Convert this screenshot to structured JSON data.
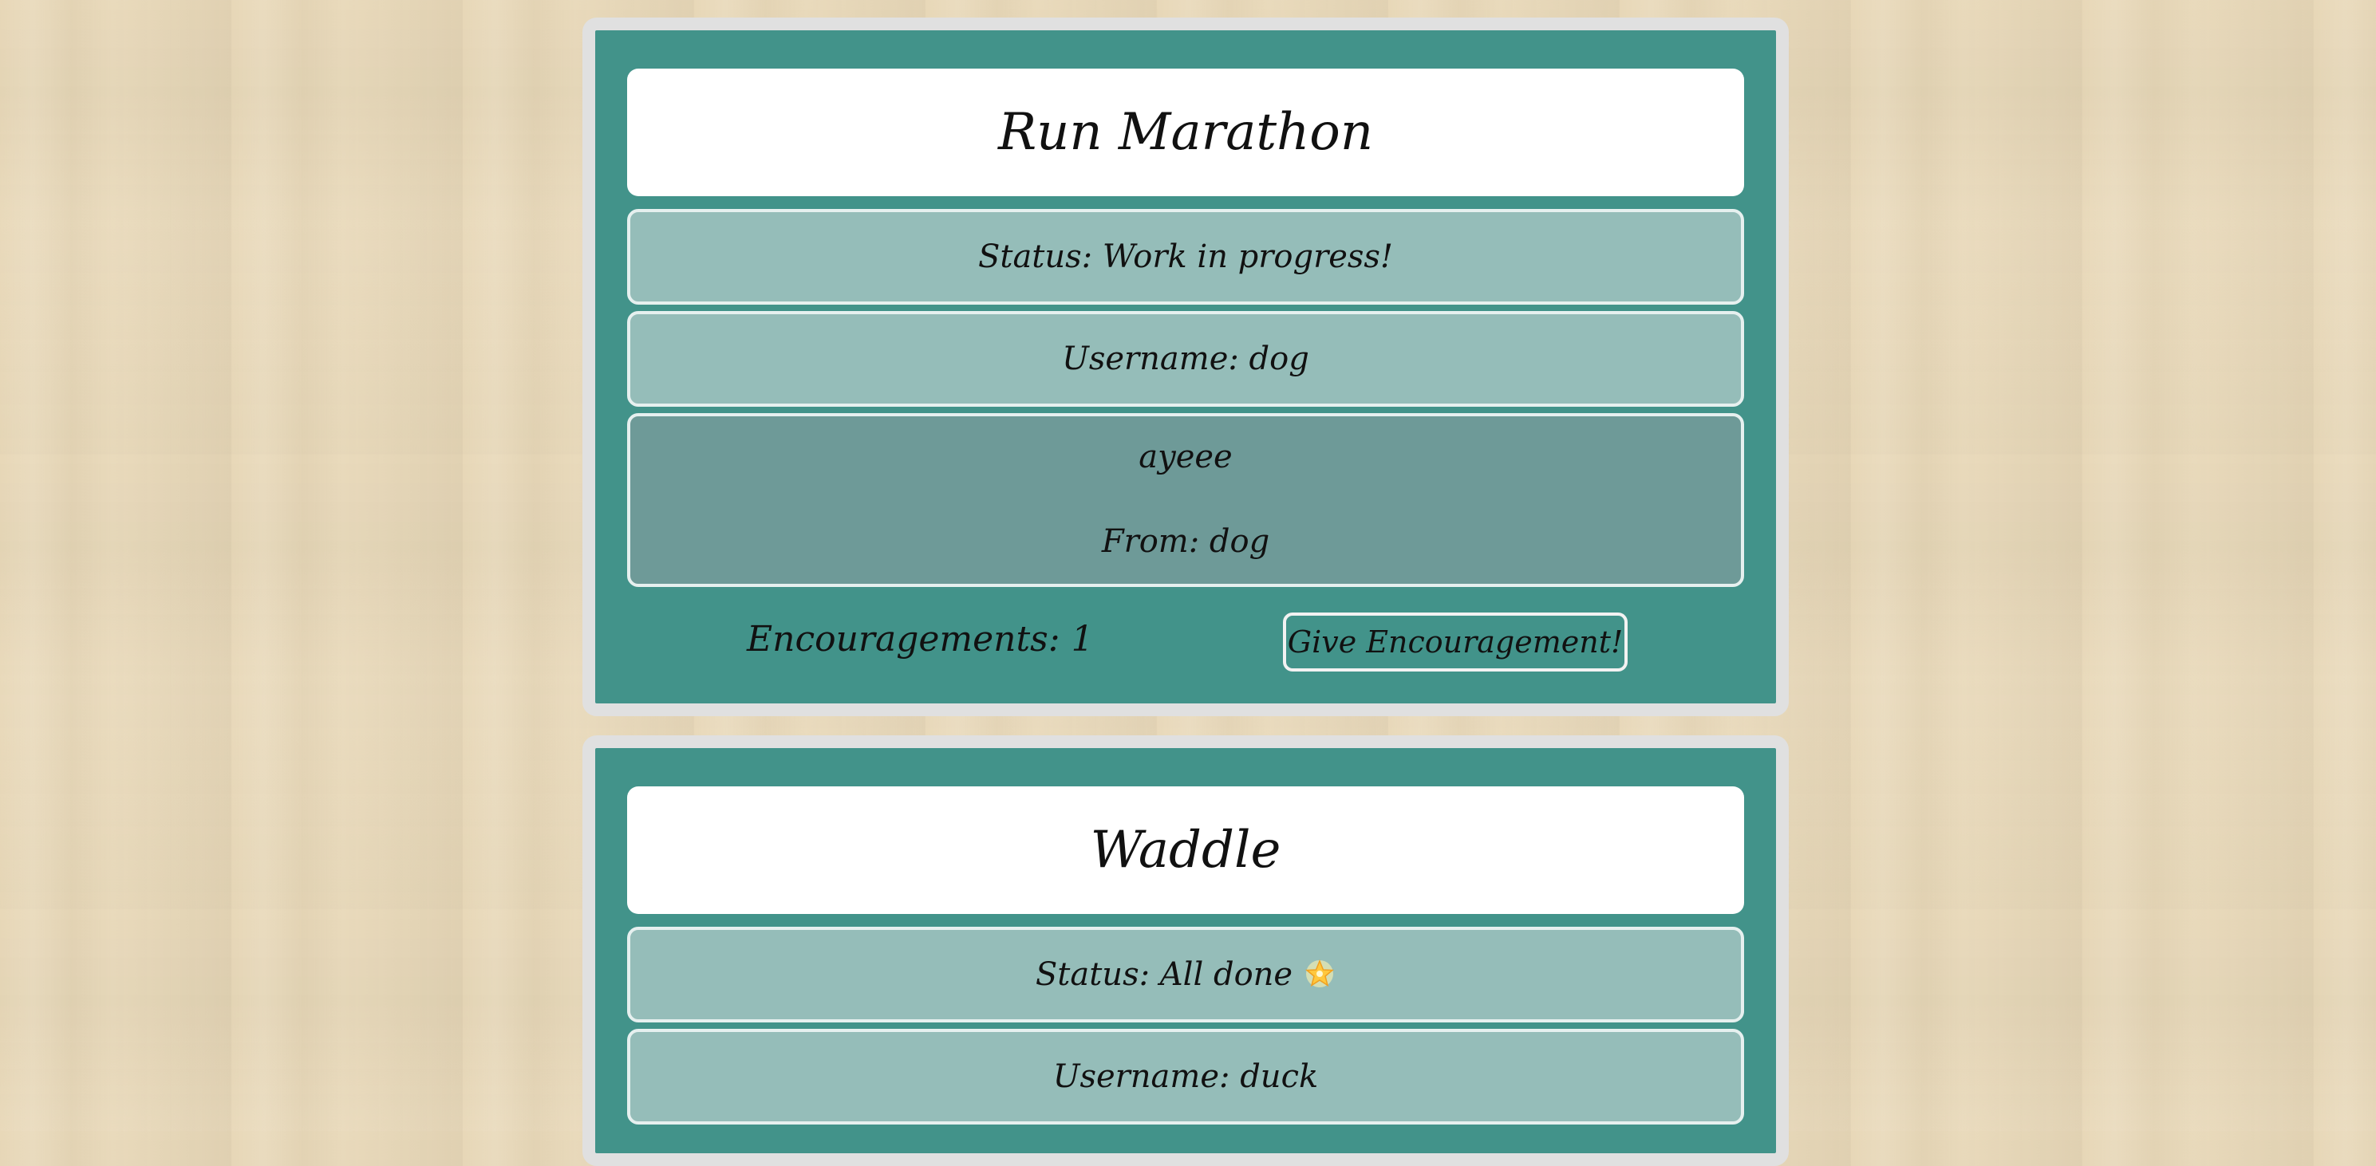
{
  "goals": [
    {
      "title": "Run Marathon",
      "status": "Status: Work in progress!",
      "username": "Username: dog",
      "message": {
        "text": "ayeee",
        "from": "From: dog"
      },
      "encouragements": "Encouragements: 1",
      "encourage_button_label": "Give Encouragement!"
    },
    {
      "title": "Waddle",
      "status": "Status: All done",
      "status_icon": "glowing-star-icon",
      "username": "Username: duck"
    }
  ],
  "colors": {
    "card_background": "#42938a",
    "card_border": "#e0e0e0",
    "info_box": "#95bdb9",
    "message_box": "#6e9a98",
    "title_box": "#ffffff",
    "page_background": "#e8d8b8"
  }
}
